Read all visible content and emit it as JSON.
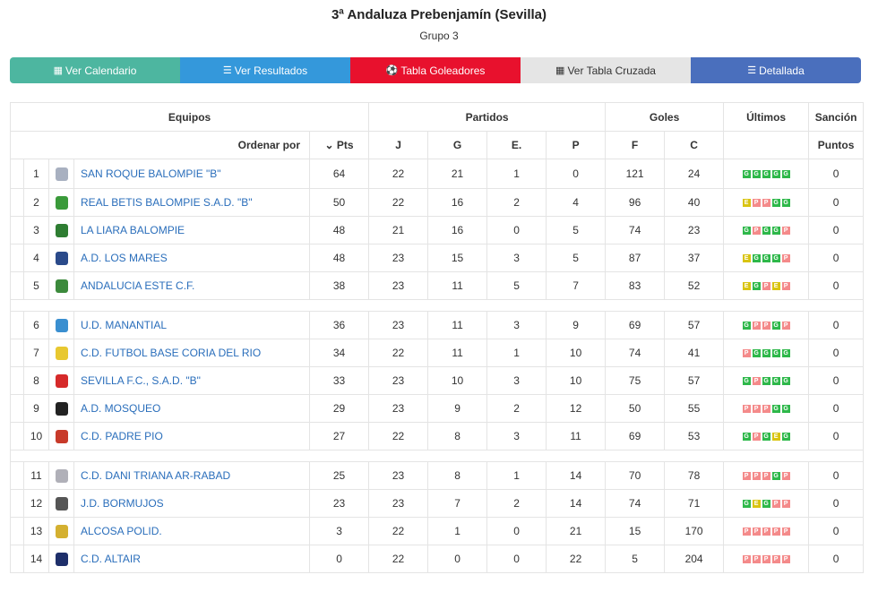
{
  "header": {
    "title": "3ª Andaluza Prebenjamín (Sevilla)",
    "group": "Grupo 3"
  },
  "buttons": [
    {
      "label": "Ver Calendario",
      "icon": "calendar-icon",
      "color": "#4db6a0"
    },
    {
      "label": "Ver Resultados",
      "icon": "list-icon",
      "color": "#3498db"
    },
    {
      "label": "Tabla Goleadores",
      "icon": "soccer-ball-icon",
      "color": "#e8112d"
    },
    {
      "label": "Ver Tabla Cruzada",
      "icon": "grid-icon",
      "color": "#e5e5e5"
    },
    {
      "label": "Detallada",
      "icon": "detail-list-icon",
      "color": "#4a6fbd"
    }
  ],
  "table": {
    "groups": {
      "equipos": "Equipos",
      "partidos": "Partidos",
      "goles": "Goles",
      "ultimos": "Últimos",
      "sancion": "Sanción"
    },
    "cols": {
      "ordenar": "Ordenar por",
      "pts": "Pts",
      "j": "J",
      "g": "G",
      "e": "E.",
      "p": "P",
      "f": "F",
      "c": "C",
      "puntos": "Puntos"
    },
    "colors": {
      "win": "#2eb84a",
      "draw": "#d9c411",
      "loss": "#f48a8a",
      "link": "#2a6ebb"
    },
    "rows": [
      {
        "pos": "1",
        "name": "SAN ROQUE BALOMPIE \"B\"",
        "pts": "64",
        "j": "22",
        "g": "21",
        "e": "1",
        "p": "0",
        "f": "121",
        "c": "24",
        "form": [
          "G",
          "G",
          "G",
          "G",
          "G"
        ],
        "sancion": "0",
        "crest": "#a8b0c0"
      },
      {
        "pos": "2",
        "name": "REAL BETIS BALOMPIE S.A.D. \"B\"",
        "pts": "50",
        "j": "22",
        "g": "16",
        "e": "2",
        "p": "4",
        "f": "96",
        "c": "40",
        "form": [
          "E",
          "P",
          "P",
          "G",
          "G"
        ],
        "sancion": "0",
        "crest": "#3a9a3a"
      },
      {
        "pos": "3",
        "name": "LA LIARA BALOMPIE",
        "pts": "48",
        "j": "21",
        "g": "16",
        "e": "0",
        "p": "5",
        "f": "74",
        "c": "23",
        "form": [
          "G",
          "P",
          "G",
          "G",
          "P"
        ],
        "sancion": "0",
        "crest": "#2e7d32"
      },
      {
        "pos": "4",
        "name": "A.D. LOS MARES",
        "pts": "48",
        "j": "23",
        "g": "15",
        "e": "3",
        "p": "5",
        "f": "87",
        "c": "37",
        "form": [
          "E",
          "G",
          "G",
          "G",
          "P"
        ],
        "sancion": "0",
        "crest": "#2a4a8a"
      },
      {
        "pos": "5",
        "name": "ANDALUCIA ESTE C.F.",
        "pts": "38",
        "j": "23",
        "g": "11",
        "e": "5",
        "p": "7",
        "f": "83",
        "c": "52",
        "form": [
          "E",
          "G",
          "P",
          "E",
          "P"
        ],
        "sancion": "0",
        "crest": "#3c8a3c"
      },
      {
        "pos": "6",
        "name": "U.D. MANANTIAL",
        "pts": "36",
        "j": "23",
        "g": "11",
        "e": "3",
        "p": "9",
        "f": "69",
        "c": "57",
        "form": [
          "G",
          "P",
          "P",
          "G",
          "P"
        ],
        "sancion": "0",
        "crest": "#3a8fd0"
      },
      {
        "pos": "7",
        "name": "C.D. FUTBOL BASE CORIA DEL RIO",
        "pts": "34",
        "j": "22",
        "g": "11",
        "e": "1",
        "p": "10",
        "f": "74",
        "c": "41",
        "form": [
          "P",
          "G",
          "G",
          "G",
          "G"
        ],
        "sancion": "0",
        "crest": "#e8c830"
      },
      {
        "pos": "8",
        "name": "SEVILLA F.C., S.A.D. \"B\"",
        "pts": "33",
        "j": "23",
        "g": "10",
        "e": "3",
        "p": "10",
        "f": "75",
        "c": "57",
        "form": [
          "G",
          "P",
          "G",
          "G",
          "G"
        ],
        "sancion": "0",
        "crest": "#d62a2a"
      },
      {
        "pos": "9",
        "name": "A.D. MOSQUEO",
        "pts": "29",
        "j": "23",
        "g": "9",
        "e": "2",
        "p": "12",
        "f": "50",
        "c": "55",
        "form": [
          "P",
          "P",
          "P",
          "G",
          "G"
        ],
        "sancion": "0",
        "crest": "#222222"
      },
      {
        "pos": "10",
        "name": "C.D. PADRE PIO",
        "pts": "27",
        "j": "22",
        "g": "8",
        "e": "3",
        "p": "11",
        "f": "69",
        "c": "53",
        "form": [
          "G",
          "P",
          "G",
          "E",
          "G"
        ],
        "sancion": "0",
        "crest": "#c83a2a"
      },
      {
        "pos": "11",
        "name": "C.D. DANI TRIANA AR-RABAD",
        "pts": "25",
        "j": "23",
        "g": "8",
        "e": "1",
        "p": "14",
        "f": "70",
        "c": "78",
        "form": [
          "P",
          "P",
          "P",
          "G",
          "P"
        ],
        "sancion": "0",
        "crest": "#b0b0b8"
      },
      {
        "pos": "12",
        "name": "J.D. BORMUJOS",
        "pts": "23",
        "j": "23",
        "g": "7",
        "e": "2",
        "p": "14",
        "f": "74",
        "c": "71",
        "form": [
          "G",
          "E",
          "G",
          "P",
          "P"
        ],
        "sancion": "0",
        "crest": "#555555"
      },
      {
        "pos": "13",
        "name": "ALCOSA POLID.",
        "pts": "3",
        "j": "22",
        "g": "1",
        "e": "0",
        "p": "21",
        "f": "15",
        "c": "170",
        "form": [
          "P",
          "P",
          "P",
          "P",
          "P"
        ],
        "sancion": "0",
        "crest": "#d4b030"
      },
      {
        "pos": "14",
        "name": "C.D. ALTAIR",
        "pts": "0",
        "j": "22",
        "g": "0",
        "e": "0",
        "p": "22",
        "f": "5",
        "c": "204",
        "form": [
          "P",
          "P",
          "P",
          "P",
          "P"
        ],
        "sancion": "0",
        "crest": "#1e2f6a"
      }
    ]
  }
}
